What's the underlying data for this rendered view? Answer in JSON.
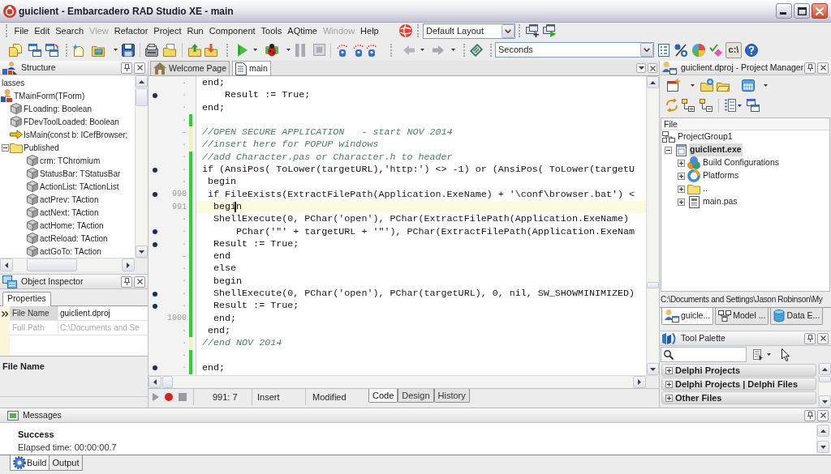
{
  "window": {
    "title": "guiclient - Embarcadero RAD Studio XE - main"
  },
  "menu": [
    {
      "label": "File",
      "disabled": false
    },
    {
      "label": "Edit",
      "disabled": false
    },
    {
      "label": "Search",
      "disabled": false
    },
    {
      "label": "View",
      "disabled": true
    },
    {
      "label": "Refactor",
      "disabled": false
    },
    {
      "label": "Project",
      "disabled": false
    },
    {
      "label": "Run",
      "disabled": false
    },
    {
      "label": "Component",
      "disabled": false
    },
    {
      "label": "Tools",
      "disabled": false
    },
    {
      "label": "AQtime",
      "disabled": false
    },
    {
      "label": "Window",
      "disabled": true
    },
    {
      "label": "Help",
      "disabled": false
    }
  ],
  "layout_selector": {
    "value": "Default Layout"
  },
  "toolbar": {
    "timer_selector": {
      "value": "Seconds"
    },
    "console_toggle": {
      "label": "c:\\",
      "pressed": true
    }
  },
  "structure": {
    "title": "Structure",
    "tree": [
      {
        "label": "lasses",
        "children": [
          {
            "label": "TMainForm(TForm)",
            "kind": "class",
            "children": [
              {
                "label": "FLoading: Boolean",
                "kind": "field"
              },
              {
                "label": "FDevToolLoaded: Boolean",
                "kind": "field"
              },
              {
                "label": "IsMain(const b: ICefBrowser;",
                "kind": "method"
              },
              {
                "label": "Published",
                "kind": "folder",
                "expanded": true,
                "children": [
                  {
                    "label": "crm: TChromium",
                    "kind": "field"
                  },
                  {
                    "label": "StatusBar: TStatusBar",
                    "kind": "field"
                  },
                  {
                    "label": "ActionList: TActionList",
                    "kind": "field"
                  },
                  {
                    "label": "actPrev: TAction",
                    "kind": "field"
                  },
                  {
                    "label": "actNext: TAction",
                    "kind": "field"
                  },
                  {
                    "label": "actHome: TAction",
                    "kind": "field"
                  },
                  {
                    "label": "actReload: TAction",
                    "kind": "field"
                  },
                  {
                    "label": "actGoTo: TAction",
                    "kind": "field"
                  }
                ]
              }
            ]
          }
        ]
      }
    ]
  },
  "object_inspector": {
    "title": "Object Inspector",
    "tabs": [
      {
        "label": "Properties",
        "selected": true
      }
    ],
    "properties": [
      {
        "name": "File Name",
        "value": "guiclient.dproj",
        "selected": true,
        "read_only": false
      },
      {
        "name": "Full Path",
        "value": "C:\\Documents and Se",
        "selected": false,
        "read_only": true
      }
    ],
    "description": "File Name"
  },
  "editor": {
    "tabs": [
      {
        "label": "Welcome Page",
        "kind": "welcome",
        "selected": false
      },
      {
        "label": "main",
        "kind": "unit",
        "selected": true
      }
    ],
    "lines": [
      {
        "gutter": "·",
        "executable": false,
        "kind": "code",
        "current": false,
        "text": "end;"
      },
      {
        "gutter": "·",
        "executable": true,
        "kind": "code",
        "current": false,
        "text": "    Result := True;"
      },
      {
        "gutter": "·",
        "executable": false,
        "kind": "code",
        "current": false,
        "text": "end;"
      },
      {
        "gutter": "·",
        "executable": false,
        "color": "#2ed22e",
        "current": false
      },
      {
        "gutter": "–",
        "executable": false,
        "color": "#f2f2b8",
        "kind": "comment",
        "current": false,
        "text": "//OPEN SECURE APPLICATION   - start NOV 2014"
      },
      {
        "gutter": "·",
        "executable": false,
        "color": "#f2f2b8",
        "kind": "comment",
        "current": false,
        "text": "//insert here for POPUP windows"
      },
      {
        "gutter": "·",
        "executable": false,
        "color": "#2ed22e",
        "kind": "comment",
        "current": false,
        "text": "//add Character.pas or Character.h to header"
      },
      {
        "gutter": "·",
        "executable": true,
        "color": "#2ed22e",
        "kind": "code",
        "current": false,
        "text": "if (AnsiPos( ToLower(targetURL),'http:') <> -1) or (AnsiPos( ToLower(targetU"
      },
      {
        "gutter": "·",
        "executable": false,
        "color": "#2ed22e",
        "kind": "code",
        "current": false,
        "text": " begin"
      },
      {
        "gutter": "990",
        "executable": true,
        "color": "#2ed22e",
        "kind": "code",
        "current": false,
        "text": " if FileExists(ExtractFilePath(Application.ExeName) + '\\conf\\browser.bat') <"
      },
      {
        "gutter": "991",
        "executable": false,
        "color": "#2ed22e",
        "kind": "code",
        "current": true,
        "text": "  begi",
        "after_caret": "n"
      },
      {
        "gutter": "·",
        "executable": false,
        "color": "#2ed22e",
        "kind": "code",
        "current": false,
        "text": "  ShellExecute(0, PChar('open'), PChar(ExtractFilePath(Application.ExeName)"
      },
      {
        "gutter": "·",
        "executable": true,
        "color": "#2ed22e",
        "kind": "code",
        "current": false,
        "text": "      PChar('\"' + targetURL + '\"'), PChar(ExtractFilePath(Application.ExeNam"
      },
      {
        "gutter": "·",
        "executable": true,
        "color": "#2ed22e",
        "kind": "code",
        "current": false,
        "text": "  Result := True;"
      },
      {
        "gutter": "–",
        "executable": false,
        "color": "#2ed22e",
        "kind": "code",
        "current": false,
        "text": "  end"
      },
      {
        "gutter": "·",
        "executable": false,
        "color": "#2ed22e",
        "kind": "code",
        "current": false,
        "text": "  else"
      },
      {
        "gutter": "·",
        "executable": false,
        "color": "#2ed22e",
        "kind": "code",
        "current": false,
        "text": "  begin"
      },
      {
        "gutter": "·",
        "executable": true,
        "color": "#2ed22e",
        "kind": "code",
        "current": false,
        "text": "  ShellExecute(0, PChar('open'), PChar(targetURL), 0, nil, SW_SHOWMINIMIZED)"
      },
      {
        "gutter": "·",
        "executable": true,
        "color": "#2ed22e",
        "kind": "code",
        "current": false,
        "text": "  Result := True;"
      },
      {
        "gutter": "1000",
        "executable": false,
        "color": "#2ed22e",
        "kind": "code",
        "current": false,
        "text": "  end;"
      },
      {
        "gutter": "·",
        "executable": false,
        "color": "#2ed22e",
        "kind": "code",
        "current": false,
        "text": " end;"
      },
      {
        "gutter": "·",
        "executable": false,
        "color": "#f2f2b8",
        "kind": "comment",
        "current": false,
        "text": "//end NOV 2014"
      },
      {
        "gutter": "·",
        "executable": false,
        "color": "#2ed22e",
        "current": false
      },
      {
        "gutter": "·",
        "executable": true,
        "color": "#2ed22e",
        "kind": "code",
        "current": false,
        "text": "end;"
      }
    ],
    "status": {
      "position": "991: 7",
      "mode": "Insert",
      "state": "Modified"
    },
    "view_tabs": [
      {
        "label": "Code",
        "selected": true
      },
      {
        "label": "Design",
        "selected": false
      },
      {
        "label": "History",
        "selected": false
      }
    ]
  },
  "project_manager": {
    "title": "guiclient.dproj - Project Manager",
    "column": "File",
    "tree": [
      {
        "label": "ProjectGroup1",
        "kind": "group",
        "selected": false,
        "children": [
          {
            "label": "guiclient.exe",
            "kind": "project",
            "selected": true,
            "expanded": true,
            "children": [
              {
                "label": "Build Configurations",
                "kind": "configurations",
                "selected": false,
                "expanded": false
              },
              {
                "label": "Platforms",
                "kind": "platforms",
                "selected": false,
                "expanded": false
              },
              {
                "label": "..",
                "kind": "folder",
                "selected": false,
                "expanded": false
              },
              {
                "label": "main.pas",
                "kind": "file",
                "selected": false,
                "expanded": false
              }
            ]
          }
        ]
      }
    ],
    "path": "C:\\Documents and Settings\\Jason Robinson\\My",
    "tabs": [
      {
        "label": "guicle...",
        "kind": "projects",
        "selected": true
      },
      {
        "label": "Model ...",
        "kind": "model",
        "selected": false
      },
      {
        "label": "Data E...",
        "kind": "data",
        "selected": false
      }
    ]
  },
  "tool_palette": {
    "title": "Tool Palette",
    "categories": [
      {
        "label": "Delphi Projects",
        "expanded": false
      },
      {
        "label": "Delphi Projects | Delphi Files",
        "expanded": false
      },
      {
        "label": "Other Files",
        "expanded": false
      }
    ]
  },
  "messages": {
    "title": "Messages",
    "lines": [
      {
        "text": "Success",
        "kind": "result"
      },
      {
        "text": "Elapsed time: 00:00:00.7",
        "kind": "detail"
      }
    ],
    "tabs": [
      {
        "label": "Build",
        "kind": "build",
        "selected": true
      },
      {
        "label": "Output",
        "kind": "output",
        "selected": false
      }
    ]
  }
}
